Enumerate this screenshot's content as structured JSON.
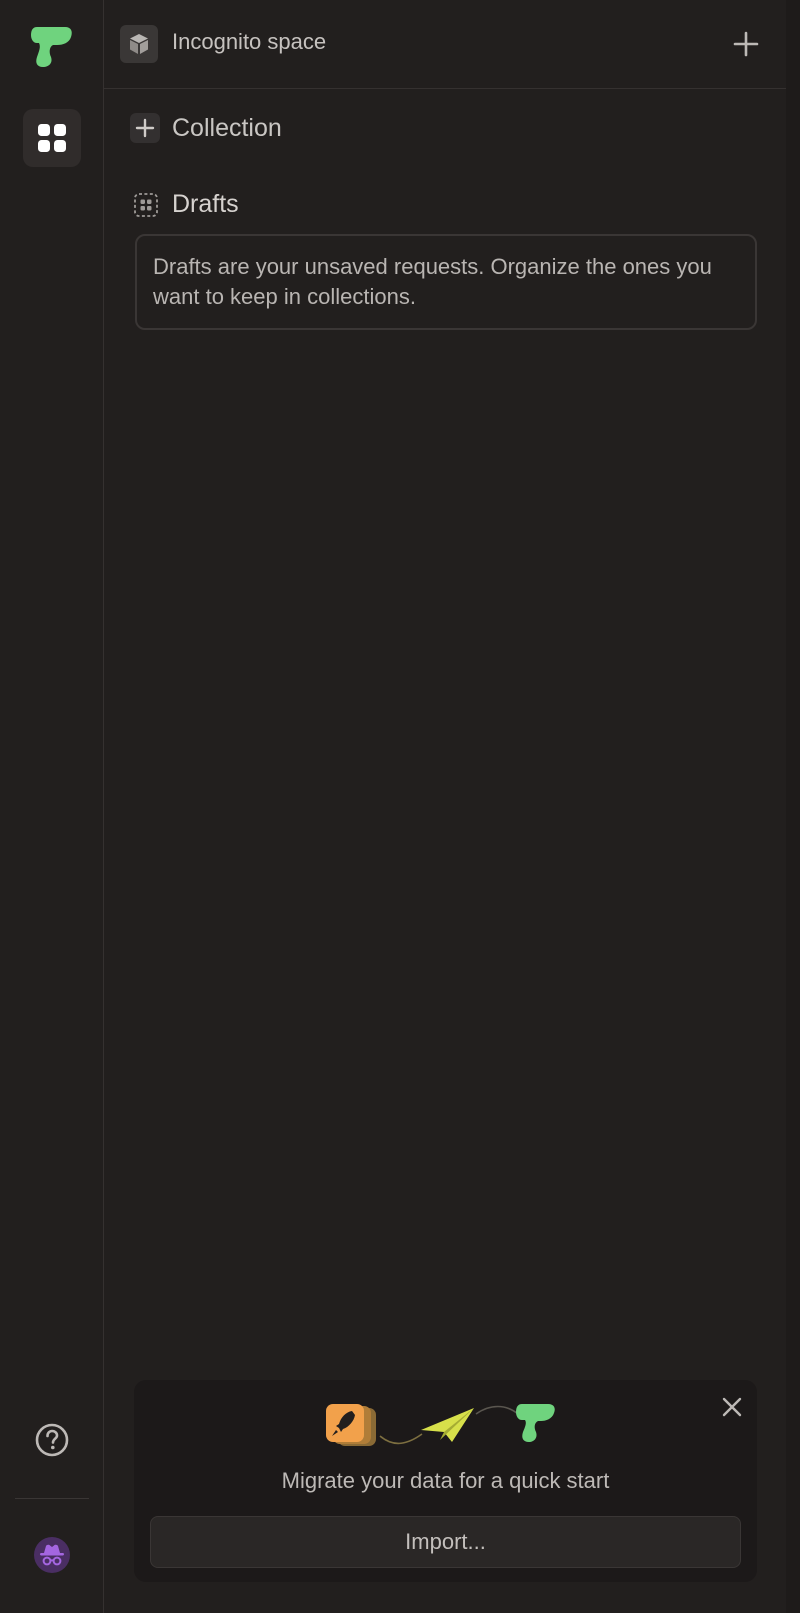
{
  "rail": {
    "logo_icon": "hoppscotch-logo-icon",
    "nav_icon": "grid-icon",
    "help_icon": "help-circle-icon",
    "avatar_icon": "incognito-icon"
  },
  "header": {
    "space_icon": "cube-icon",
    "title": "Incognito space",
    "add_icon": "plus-icon"
  },
  "collection": {
    "label": "Collection"
  },
  "drafts": {
    "label": "Drafts",
    "description": "Drafts are your unsaved requests. Organize the ones you want to keep in collections."
  },
  "migrate": {
    "text": "Migrate your data for a quick start",
    "import_label": "Import...",
    "close_icon": "close-icon"
  },
  "colors": {
    "background": "#221f1e",
    "brand_green": "#6fd37e",
    "accent_orange": "#f2a14b",
    "avatar_purple": "#a466e0"
  }
}
